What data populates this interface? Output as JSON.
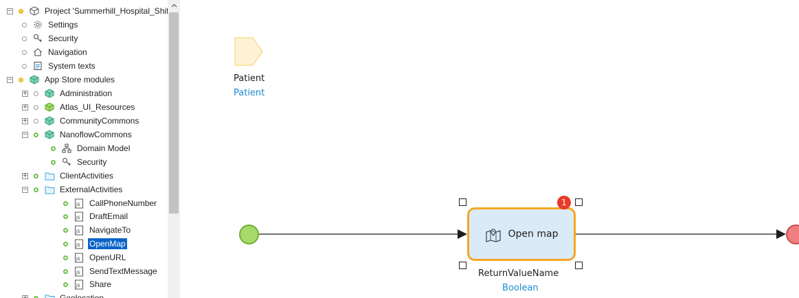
{
  "explorer": {
    "items": [
      {
        "label": "Project 'Summerhill_Hospital_Shift"
      },
      {
        "label": "Settings"
      },
      {
        "label": "Security"
      },
      {
        "label": "Navigation"
      },
      {
        "label": "System texts"
      },
      {
        "label": "App Store modules"
      },
      {
        "label": "Administration"
      },
      {
        "label": "Atlas_UI_Resources"
      },
      {
        "label": "CommunityCommons"
      },
      {
        "label": "NanoflowCommons"
      },
      {
        "label": "Domain Model"
      },
      {
        "label": "Security"
      },
      {
        "label": "ClientActivities"
      },
      {
        "label": "ExternalActivities"
      },
      {
        "label": "CallPhoneNumber"
      },
      {
        "label": "DraftEmail"
      },
      {
        "label": "NavigateTo"
      },
      {
        "label": "OpenMap"
      },
      {
        "label": "OpenURL"
      },
      {
        "label": "SendTextMessage"
      },
      {
        "label": "Share"
      },
      {
        "label": "Geolocation"
      }
    ]
  },
  "canvas": {
    "parameter": {
      "name": "Patient",
      "type": "Patient"
    },
    "action": {
      "label": "Open map",
      "badge": "1",
      "return_name": "ReturnValueName",
      "return_type": "Boolean"
    }
  },
  "colors": {
    "selection": "#0a64c8",
    "activity_border": "#f5a623",
    "activity_fill": "#dbeaf7",
    "start_event": "#a6d96a",
    "end_event": "#f08080",
    "error_badge": "#e83a2c",
    "type_text": "#1a8ccf"
  }
}
